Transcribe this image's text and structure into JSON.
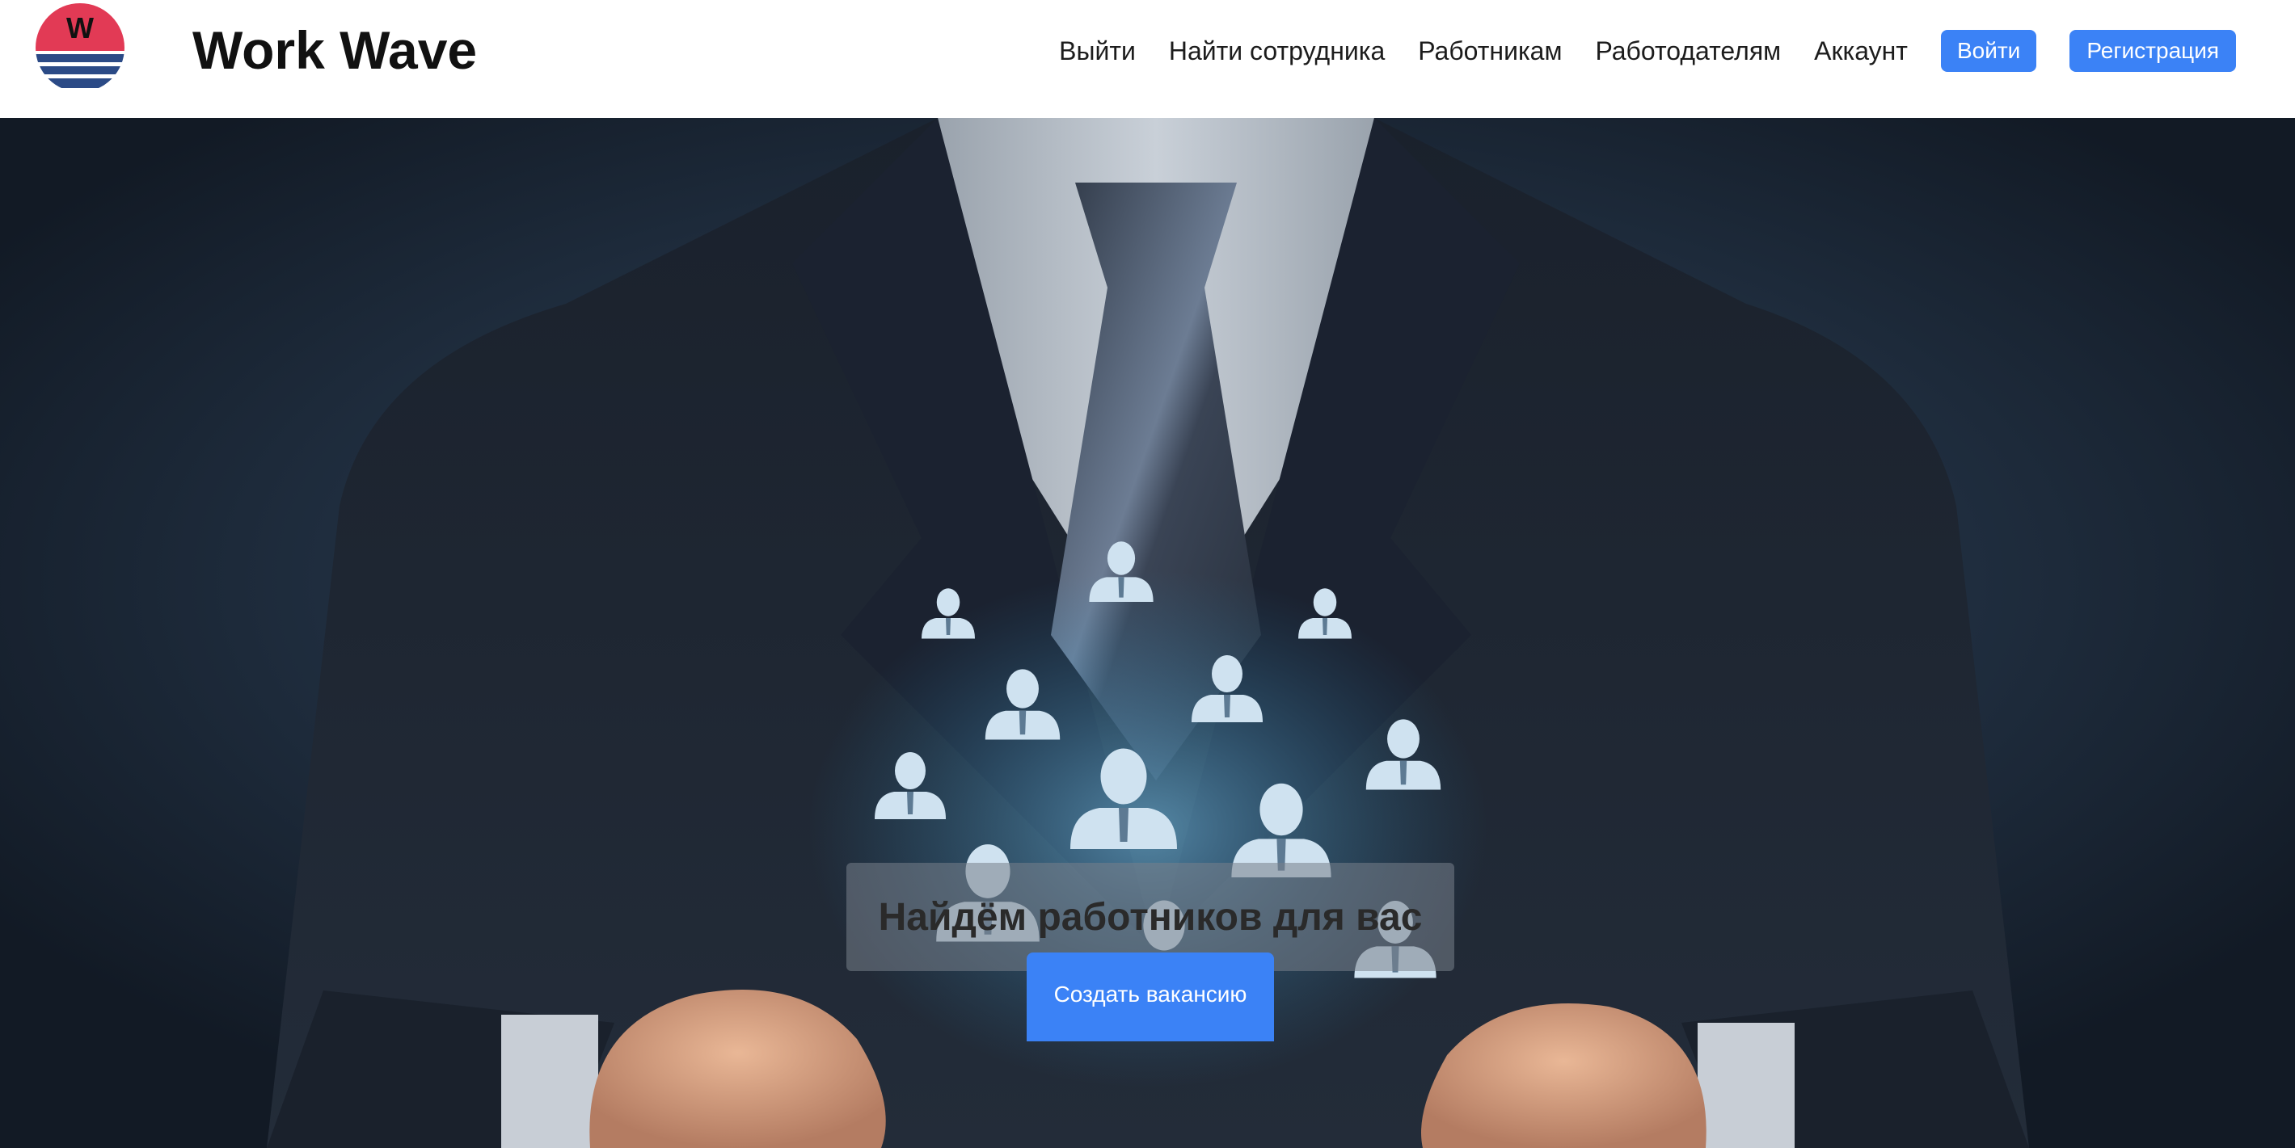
{
  "brand": {
    "logo_letter": "W",
    "name": "Work Wave"
  },
  "nav": {
    "links": [
      "Выйти",
      "Найти сотрудника",
      "Работникам",
      "Работодателям",
      "Аккаунт"
    ],
    "login_label": "Войти",
    "register_label": "Регистрация"
  },
  "hero": {
    "image": "businessman-holding-glowing-people-icons",
    "headline": "Найдём работников для вас",
    "cta_label": "Создать вакансию"
  },
  "colors": {
    "accent": "#3b82f6",
    "logo_red": "#e23a55",
    "logo_blue": "#2b4a86"
  }
}
